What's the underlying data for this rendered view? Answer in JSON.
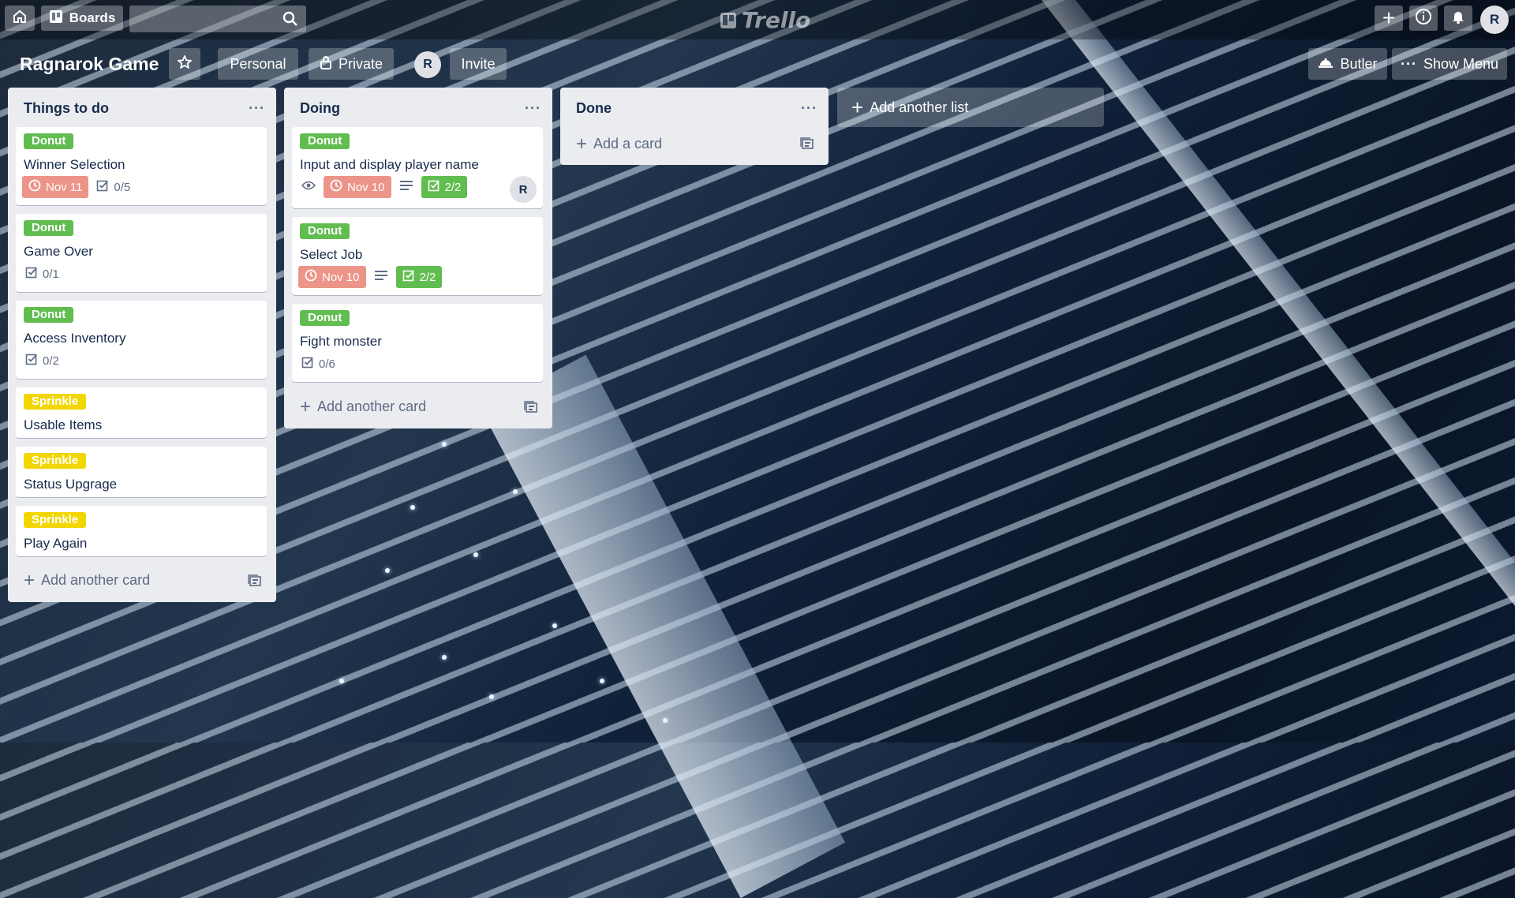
{
  "header": {
    "boards_label": "Boards",
    "logo_text": "Trello",
    "account_initial": "R"
  },
  "board": {
    "title": "Ragnarok Game",
    "team_label": "Personal",
    "visibility_label": "Private",
    "member_initial": "R",
    "invite_label": "Invite",
    "butler_label": "Butler",
    "menu_label": "Show Menu"
  },
  "lists": [
    {
      "title": "Things to do",
      "add_label": "Add another card",
      "cards": [
        {
          "label": "Donut",
          "title": "Winner Selection",
          "due": "Nov 11",
          "checklist": "0/5"
        },
        {
          "label": "Donut",
          "title": "Game Over",
          "checklist": "0/1"
        },
        {
          "label": "Donut",
          "title": "Access Inventory",
          "checklist": "0/2"
        },
        {
          "label": "Sprinkle",
          "title": "Usable Items"
        },
        {
          "label": "Sprinkle",
          "title": "Status Upgrage"
        },
        {
          "label": "Sprinkle",
          "title": "Play Again"
        }
      ]
    },
    {
      "title": "Doing",
      "add_label": "Add another card",
      "cards": [
        {
          "label": "Donut",
          "title": "Input and display player name",
          "due": "Nov 10",
          "checklist": "2/2",
          "member": "R"
        },
        {
          "label": "Donut",
          "title": "Select Job",
          "due": "Nov 10",
          "checklist": "2/2"
        },
        {
          "label": "Donut",
          "title": "Fight monster",
          "checklist": "0/6"
        }
      ]
    },
    {
      "title": "Done",
      "add_label": "Add a card",
      "cards": []
    }
  ],
  "add_list_label": "Add another list",
  "colors": {
    "label_green": "#61bd4f",
    "label_yellow": "#f2d600",
    "due_red": "#ec9488",
    "list_bg": "#ebecf0"
  }
}
